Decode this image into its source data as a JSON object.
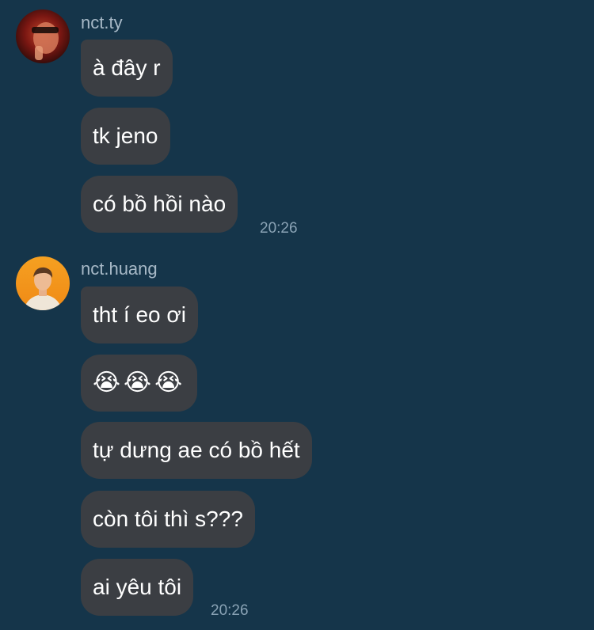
{
  "groups": [
    {
      "sender": "nct.ty",
      "messages": [
        "à đây r",
        "tk jeno",
        "có bồ hồi nào"
      ],
      "time": "20:26"
    },
    {
      "sender": "nct.huang",
      "messages": [
        "tht í eo ơi",
        "😭😭😭",
        "tự dưng ae có bồ hết",
        "còn tôi thì s???",
        "ai yêu tôi"
      ],
      "time": "20:26"
    }
  ],
  "colors": {
    "background": "#15354a",
    "bubble": "#3b3e43",
    "text": "#ffffff",
    "meta": "#8aa3b5"
  }
}
